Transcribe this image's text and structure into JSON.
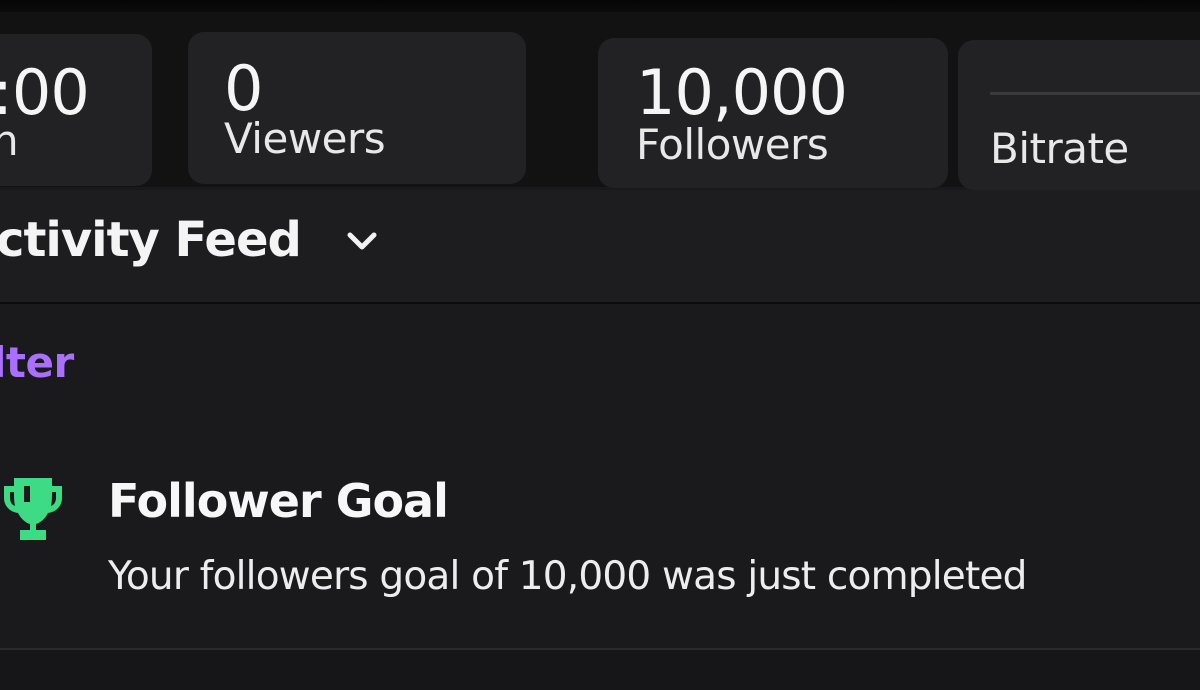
{
  "stats": {
    "time": {
      "value": ":00",
      "label": "n"
    },
    "viewers": {
      "value": "0",
      "label": "Viewers"
    },
    "followers": {
      "value": "10,000",
      "label": "Followers"
    },
    "bitrate": {
      "label": "Bitrate"
    }
  },
  "feed": {
    "title": "ctivity Feed",
    "filter_label": "lter",
    "items": [
      {
        "icon": "trophy-icon",
        "title": "Follower Goal",
        "description": "Your followers goal of 10,000 was just completed"
      }
    ]
  },
  "colors": {
    "accent": "#a970ff",
    "trophy": "#3ddc84",
    "card": "#222225",
    "background": "#1a1a1c"
  }
}
